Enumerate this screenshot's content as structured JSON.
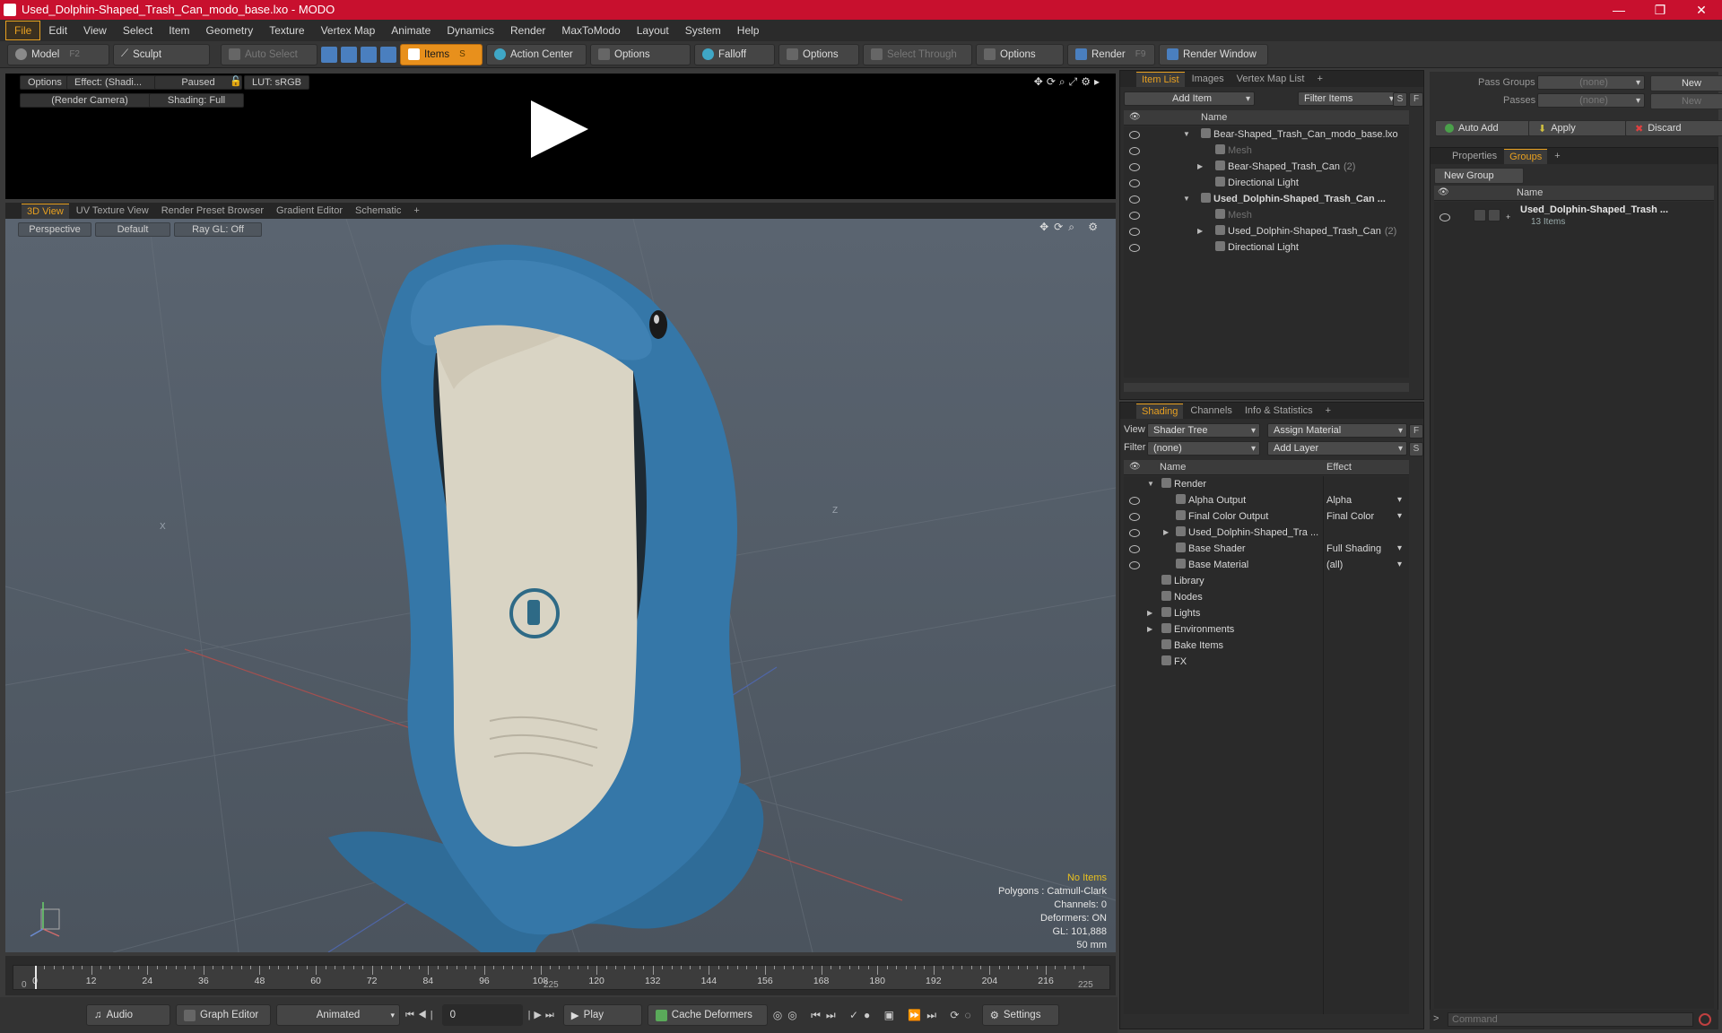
{
  "window": {
    "title": "Used_Dolphin-Shaped_Trash_Can_modo_base.lxo - MODO",
    "controls": [
      "—",
      "❐",
      "✕"
    ]
  },
  "menu": [
    "File",
    "Edit",
    "View",
    "Select",
    "Item",
    "Geometry",
    "Texture",
    "Vertex Map",
    "Animate",
    "Dynamics",
    "Render",
    "MaxToModo",
    "Layout",
    "System",
    "Help"
  ],
  "toolbar": {
    "model": "Model",
    "model_key": "F2",
    "sculpt": "Sculpt",
    "auto_select": "Auto Select",
    "items": "Items",
    "items_key": "S",
    "action_center": "Action Center",
    "options1": "Options",
    "falloff": "Falloff",
    "options2": "Options",
    "select_through": "Select Through",
    "options3": "Options",
    "render": "Render",
    "render_key": "F9",
    "render_window": "Render Window"
  },
  "preview": {
    "options": "Options",
    "effect": "Effect: (Shadi...",
    "paused": "Paused",
    "lut": "LUT: sRGB",
    "camera": "(Render Camera)",
    "shading": "Shading: Full"
  },
  "viewport_tabs": [
    "3D View",
    "UV Texture View",
    "Render Preset Browser",
    "Gradient Editor",
    "Schematic",
    "+"
  ],
  "viewport": {
    "perspective": "Perspective",
    "default": "Default",
    "raygl": "Ray GL: Off",
    "stats": {
      "no_items": "No Items",
      "polygons": "Polygons : Catmull-Clark",
      "channels": "Channels: 0",
      "deformers": "Deformers: ON",
      "gl": "GL: 101,888",
      "focal": "50 mm"
    },
    "axis_labels": {
      "x": "X",
      "z": "Z"
    }
  },
  "timeline": {
    "ticks": [
      0,
      12,
      24,
      36,
      48,
      60,
      72,
      84,
      96,
      108,
      120,
      132,
      144,
      156,
      168,
      180,
      192,
      204,
      216
    ],
    "range_start": "0",
    "range_mid": "225",
    "range_end": "225"
  },
  "bottombar": {
    "audio": "Audio",
    "graph_editor": "Graph Editor",
    "animated": "Animated",
    "frame": "0",
    "play": "Play",
    "cache_deformers": "Cache Deformers",
    "settings": "Settings"
  },
  "itemlist": {
    "tabs": [
      "Item List",
      "Images",
      "Vertex Map List",
      "+"
    ],
    "add_item": "Add Item",
    "filter_items": "Filter Items",
    "s": "S",
    "f": "F",
    "col_name": "Name",
    "rows": [
      {
        "label": "Bear-Shaped_Trash_Can_modo_base.lxo",
        "indent": 0,
        "arrow": "▼",
        "bold": false,
        "dim": false,
        "suffix": ""
      },
      {
        "label": "Mesh",
        "indent": 1,
        "arrow": "",
        "bold": false,
        "dim": true,
        "suffix": ""
      },
      {
        "label": "Bear-Shaped_Trash_Can",
        "indent": 1,
        "arrow": "▶",
        "bold": false,
        "dim": false,
        "suffix": "(2)"
      },
      {
        "label": "Directional Light",
        "indent": 1,
        "arrow": "",
        "bold": false,
        "dim": false,
        "suffix": ""
      },
      {
        "label": "Used_Dolphin-Shaped_Trash_Can ...",
        "indent": 0,
        "arrow": "▼",
        "bold": true,
        "dim": false,
        "suffix": ""
      },
      {
        "label": "Mesh",
        "indent": 1,
        "arrow": "",
        "bold": false,
        "dim": true,
        "suffix": ""
      },
      {
        "label": "Used_Dolphin-Shaped_Trash_Can",
        "indent": 1,
        "arrow": "▶",
        "bold": false,
        "dim": false,
        "suffix": "(2)"
      },
      {
        "label": "Directional Light",
        "indent": 1,
        "arrow": "",
        "bold": false,
        "dim": false,
        "suffix": ""
      }
    ]
  },
  "shading": {
    "tabs": [
      "Shading",
      "Channels",
      "Info & Statistics",
      "+"
    ],
    "view_label": "View",
    "view_value": "Shader Tree",
    "assign_material": "Assign Material",
    "filter_label": "Filter",
    "filter_value": "(none)",
    "add_layer": "Add Layer",
    "f": "F",
    "s": "S",
    "col_name": "Name",
    "col_effect": "Effect",
    "rows": [
      {
        "label": "Render",
        "indent": 0,
        "arrow": "▼",
        "effect": "",
        "eye": false
      },
      {
        "label": "Alpha Output",
        "indent": 1,
        "arrow": "",
        "effect": "Alpha",
        "eye": true
      },
      {
        "label": "Final Color Output",
        "indent": 1,
        "arrow": "",
        "effect": "Final Color",
        "eye": true
      },
      {
        "label": "Used_Dolphin-Shaped_Tra ...",
        "indent": 1,
        "arrow": "▶",
        "effect": "",
        "eye": true
      },
      {
        "label": "Base Shader",
        "indent": 1,
        "arrow": "",
        "effect": "Full Shading",
        "eye": true
      },
      {
        "label": "Base Material",
        "indent": 1,
        "arrow": "",
        "effect": "(all)",
        "eye": true
      },
      {
        "label": "Library",
        "indent": 0,
        "arrow": "",
        "effect": "",
        "eye": false
      },
      {
        "label": "Nodes",
        "indent": 0,
        "arrow": "",
        "effect": "",
        "eye": false
      },
      {
        "label": "Lights",
        "indent": 0,
        "arrow": "▶",
        "effect": "",
        "eye": false
      },
      {
        "label": "Environments",
        "indent": 0,
        "arrow": "▶",
        "effect": "",
        "eye": false
      },
      {
        "label": "Bake Items",
        "indent": 0,
        "arrow": "",
        "effect": "",
        "eye": false
      },
      {
        "label": "FX",
        "indent": 0,
        "arrow": "",
        "effect": "",
        "eye": false
      }
    ]
  },
  "passgroups": {
    "pass_groups_label": "Pass Groups",
    "pass_groups_value": "(none)",
    "new": "New",
    "passes_label": "Passes",
    "passes_value": "(none)",
    "new2": "New",
    "auto_add": "Auto Add",
    "apply": "Apply",
    "discard": "Discard"
  },
  "groups": {
    "tabs": [
      "Properties",
      "Groups",
      "+"
    ],
    "new_group": "New Group",
    "col_name": "Name",
    "item_name": "Used_Dolphin-Shaped_Trash ...",
    "item_count": "13 Items"
  },
  "command": {
    "placeholder": "Command"
  }
}
